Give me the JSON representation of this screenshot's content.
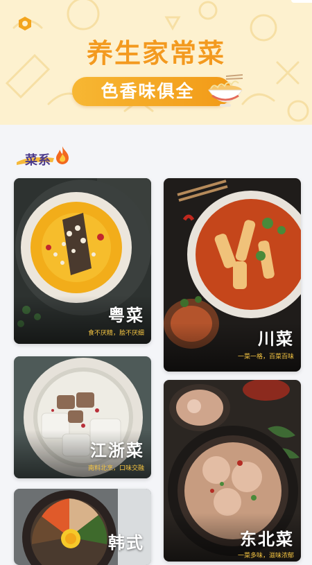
{
  "banner": {
    "title": "养生家常菜",
    "subtitle": "色香味俱全",
    "accent": "#f39a1f",
    "background": "#fdf1cf",
    "icons": [
      "hexagon-nut-icon",
      "noodle-bowl-icon"
    ]
  },
  "section": {
    "title": "菜系",
    "icon": "fire-icon"
  },
  "cuisines": [
    {
      "name": "粤菜",
      "desc": "食不厌精，脍不厌细"
    },
    {
      "name": "川菜",
      "desc": "一菜一格，百菜百味"
    },
    {
      "name": "江浙菜",
      "desc": "南料北烹，口味交融"
    },
    {
      "name": "东北菜",
      "desc": "一菜多味，滋味浓郁"
    },
    {
      "name": "韩式",
      "desc": ""
    }
  ],
  "colors": {
    "page_bg": "#f4f5f8",
    "desc_text": "#f5c542"
  }
}
